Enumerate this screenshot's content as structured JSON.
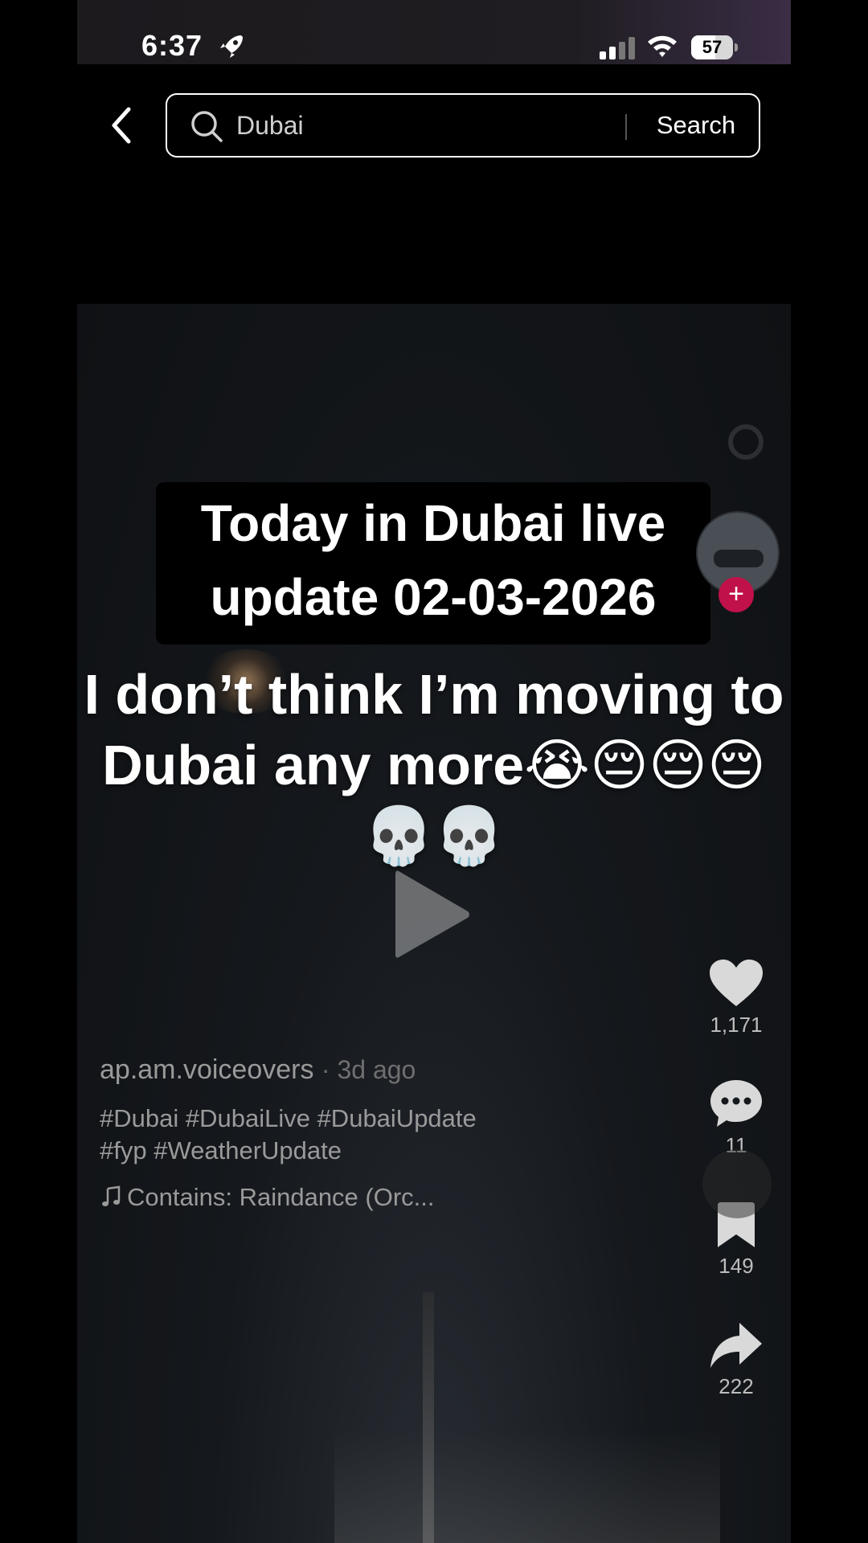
{
  "status_bar": {
    "time": "6:37",
    "battery_level": "57",
    "battery_fraction": 0.57
  },
  "search": {
    "query": "Dubai",
    "submit_label": "Search"
  },
  "video": {
    "overlay_title_line1": "Today in Dubai live",
    "overlay_title_line2": "update 02-03-2026",
    "caption_line1": "I don’t think I’m moving to",
    "caption_line2": "Dubai any more😭😔😔😔",
    "caption_line3": "💀💀",
    "author": "ap.am.voiceovers",
    "posted": "· 3d ago",
    "hashtags_line1": "#Dubai #DubaiLive #DubaiUpdate",
    "hashtags_line2": "#fyp  #WeatherUpdate",
    "music": "Contains: Raindance (Orc..."
  },
  "actions": {
    "likes": "1,171",
    "comments": "11",
    "saves": "149",
    "shares": "222"
  },
  "icons": [
    "rocket-icon",
    "cellular-signal-icon",
    "wifi-icon",
    "battery-icon",
    "back-arrow-icon",
    "search-icon",
    "play-icon",
    "heart-icon",
    "comment-icon",
    "bookmark-icon",
    "share-icon",
    "music-note-icon"
  ]
}
